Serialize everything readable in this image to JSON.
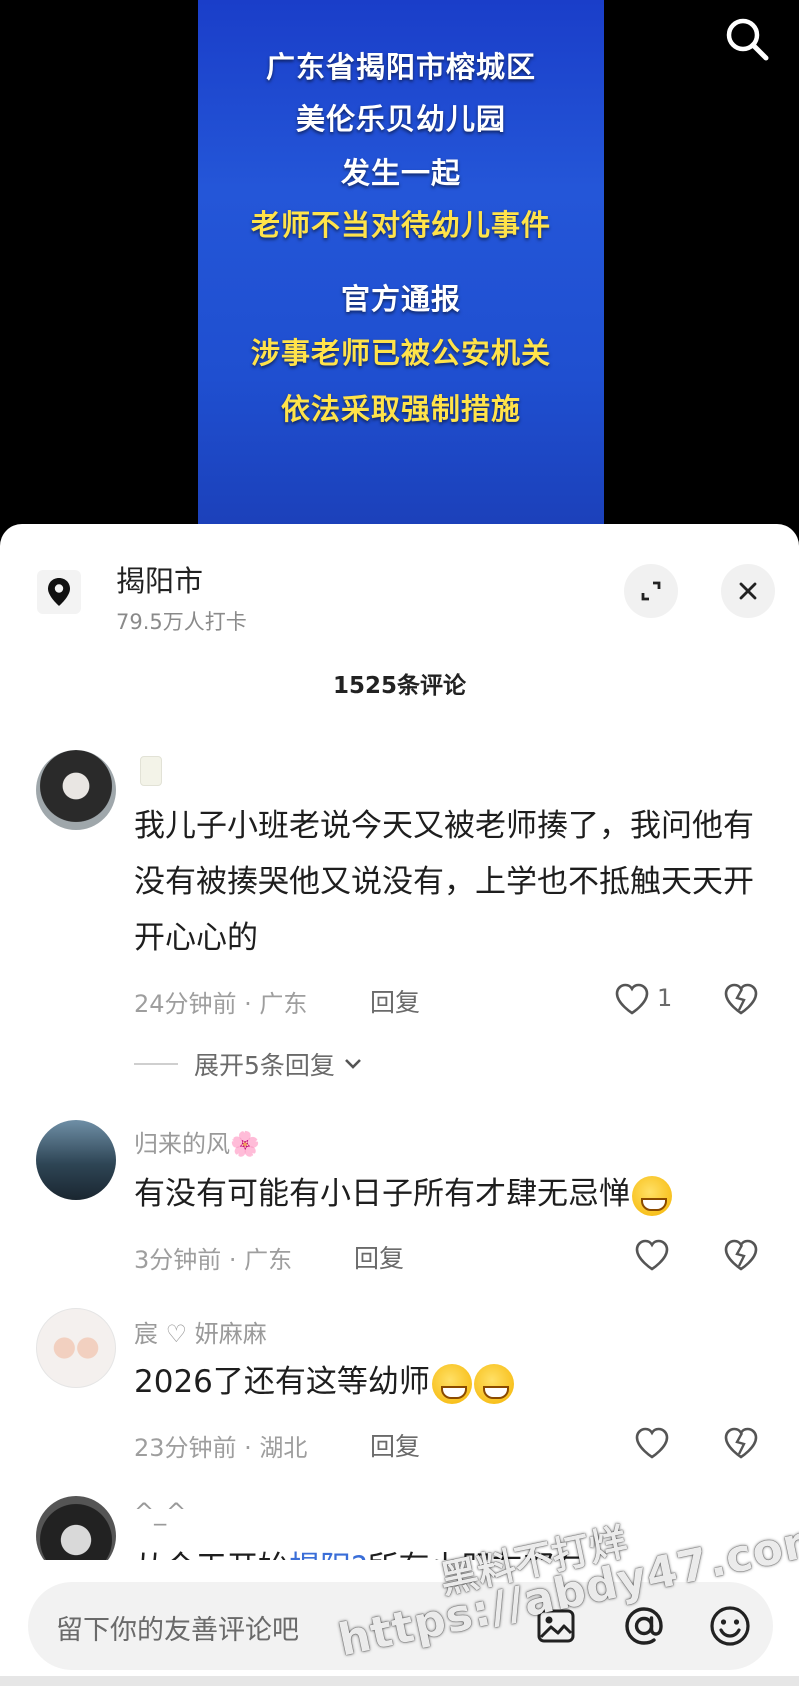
{
  "video": {
    "lines": [
      {
        "text": "广东省揭阳市榕城区",
        "color": "white"
      },
      {
        "text": "美伦乐贝幼儿园",
        "color": "white"
      },
      {
        "text": "发生一起",
        "color": "white"
      },
      {
        "text": "老师不当对待幼儿事件",
        "color": "yellow"
      },
      {
        "text": "官方通报",
        "color": "white"
      },
      {
        "text": "涉事老师已被公安机关",
        "color": "yellow"
      },
      {
        "text": "依法采取强制措施",
        "color": "yellow"
      }
    ],
    "search_icon": "search-icon"
  },
  "location": {
    "name": "揭阳市",
    "checkins": "79.5万人打卡",
    "icon": "location-pin-icon"
  },
  "comments_header": {
    "count_label": "1525条评论"
  },
  "comments": [
    {
      "username": "",
      "text": "我儿子小班老说今天又被老师揍了，我问他有没有被揍哭他又说没有，上学也不抵触天天开开心心的",
      "time_location": "24分钟前 · 广东",
      "reply_label": "回复",
      "likes": "1",
      "expand_label": "展开5条回复"
    },
    {
      "username": "归来的风🌸",
      "text": "有没有可能有小日子所有才肆无忌惮",
      "time_location": "3分钟前 · 广东",
      "reply_label": "回复",
      "likes": ""
    },
    {
      "username": "宸 ♡ 妍麻麻",
      "text": "2026了还有这等幼师",
      "time_location": "23分钟前 · 湖北",
      "reply_label": "回复",
      "likes": ""
    },
    {
      "username": "^_^",
      "text_prefix": "从今天开始",
      "text_link": "揭阳?",
      "text_suffix": "所有小朋友都在一"
    }
  ],
  "input": {
    "placeholder": "留下你的友善评论吧",
    "icons": [
      "image-icon",
      "at-icon",
      "emoji-icon"
    ]
  },
  "watermark": {
    "line1": "黑料不打烊",
    "line2": "https://abdy47.com"
  }
}
